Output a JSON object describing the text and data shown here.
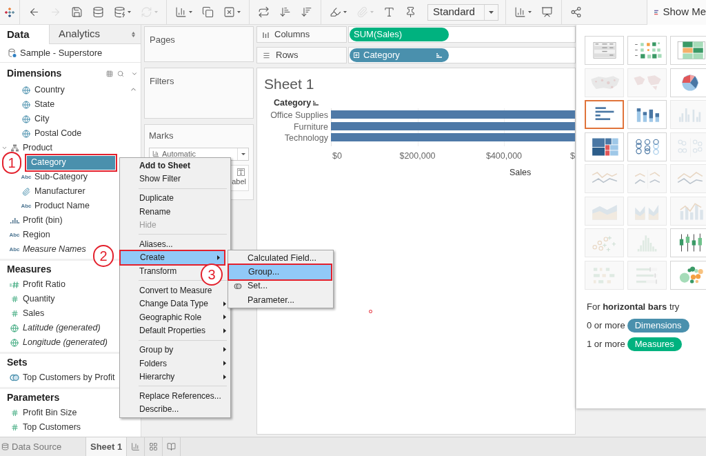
{
  "toolbar": {
    "groups": [
      {
        "items": [
          {
            "kind": "back",
            "disabled": false,
            "has_menu": false
          },
          {
            "kind": "forward",
            "disabled": true,
            "has_menu": false
          },
          {
            "kind": "save",
            "disabled": false,
            "has_menu": false
          },
          {
            "kind": "new_data_source",
            "disabled": false,
            "has_menu": false
          },
          {
            "kind": "pause_updates",
            "disabled": false,
            "has_menu": true
          },
          {
            "kind": "refresh",
            "disabled": true,
            "has_menu": true
          }
        ]
      },
      {
        "items": [
          {
            "kind": "new_sheet",
            "disabled": false,
            "has_menu": true
          },
          {
            "kind": "duplicate",
            "disabled": false,
            "has_menu": false
          },
          {
            "kind": "clear",
            "disabled": false,
            "has_menu": true
          }
        ]
      },
      {
        "items": [
          {
            "kind": "swap",
            "disabled": false,
            "has_menu": false
          },
          {
            "kind": "sort_ascending",
            "disabled": false,
            "has_menu": false
          },
          {
            "kind": "sort_descending",
            "disabled": false,
            "has_menu": false
          }
        ]
      },
      {
        "items": [
          {
            "kind": "highlight",
            "disabled": false,
            "has_menu": true
          },
          {
            "kind": "group_members",
            "disabled": true,
            "has_menu": true
          },
          {
            "kind": "labels",
            "disabled": false,
            "has_menu": false
          },
          {
            "kind": "fix_axes",
            "disabled": false,
            "has_menu": false
          },
          {
            "kind": "fit",
            "value": "Standard"
          }
        ]
      },
      {
        "items": [
          {
            "kind": "show_cards",
            "disabled": false,
            "has_menu": true
          },
          {
            "kind": "presentation",
            "disabled": false,
            "has_menu": false
          }
        ]
      },
      {
        "items": [
          {
            "kind": "share",
            "disabled": false,
            "has_menu": false
          }
        ]
      }
    ],
    "show_me_tab": {
      "label": "Show Me"
    }
  },
  "data_pane": {
    "tabs": [
      {
        "label": "Data",
        "selected": true
      },
      {
        "label": "Analytics",
        "selected": false
      }
    ],
    "data_source": "Sample - Superstore",
    "sections": [
      {
        "title": "Dimensions",
        "has_tools": true,
        "continued_items": [
          {
            "name": "Country",
            "kind": "geo",
            "italic": false,
            "selected": false,
            "annotated": false
          },
          {
            "name": "State",
            "kind": "geo",
            "italic": false,
            "selected": false,
            "annotated": false
          },
          {
            "name": "City",
            "kind": "geo",
            "italic": false,
            "selected": false,
            "annotated": false
          },
          {
            "name": "Postal Code",
            "kind": "geo",
            "italic": false,
            "selected": false,
            "annotated": false
          }
        ],
        "items": [
          {
            "name": "Product",
            "kind": "hierarchy",
            "italic": false,
            "selected": false,
            "annotated": false,
            "expanded": true,
            "children": [
              {
                "name": "Category",
                "kind": "string",
                "italic": false,
                "selected": true,
                "annotated": true
              },
              {
                "name": "Sub-Category",
                "kind": "string",
                "type_label": "Abc",
                "italic": false,
                "selected": false,
                "annotated": false
              },
              {
                "name": "Manufacturer",
                "kind": "group",
                "italic": false,
                "selected": false,
                "annotated": false
              },
              {
                "name": "Product Name",
                "kind": "string",
                "type_label": "Abc",
                "italic": false,
                "selected": false,
                "annotated": false
              }
            ]
          },
          {
            "name": "Profit (bin)",
            "kind": "bin",
            "italic": false,
            "selected": false,
            "annotated": false
          },
          {
            "name": "Region",
            "kind": "string",
            "type_label": "Abc",
            "italic": false,
            "selected": false,
            "annotated": false
          },
          {
            "name": "Measure Names",
            "kind": "string",
            "type_label": "Abc",
            "italic": true,
            "selected": false,
            "annotated": false
          }
        ]
      },
      {
        "title": "Measures",
        "has_tools": false,
        "items": [
          {
            "name": "Profit Ratio",
            "kind": "calc_measure",
            "italic": false,
            "selected": false,
            "annotated": false
          },
          {
            "name": "Quantity",
            "kind": "measure",
            "italic": false,
            "selected": false,
            "annotated": false
          },
          {
            "name": "Sales",
            "kind": "measure",
            "italic": false,
            "selected": false,
            "annotated": false
          },
          {
            "name": "Latitude (generated)",
            "kind": "geo_measure",
            "italic": true,
            "selected": false,
            "annotated": false
          },
          {
            "name": "Longitude (generated)",
            "kind": "geo_measure",
            "italic": true,
            "selected": false,
            "annotated": false
          }
        ]
      },
      {
        "title": "Sets",
        "has_tools": false,
        "items": [
          {
            "name": "Top Customers by Profit",
            "kind": "set",
            "italic": false,
            "selected": false,
            "annotated": false
          }
        ]
      },
      {
        "title": "Parameters",
        "has_tools": false,
        "items": [
          {
            "name": "Profit Bin Size",
            "kind": "parameter",
            "italic": false,
            "selected": false,
            "annotated": false
          },
          {
            "name": "Top Customers",
            "kind": "parameter",
            "italic": false,
            "selected": false,
            "annotated": false
          }
        ]
      }
    ]
  },
  "cards": {
    "pages": {
      "title": "Pages"
    },
    "filters": {
      "title": "Filters"
    },
    "marks": {
      "title": "Marks",
      "mark_type": "Automatic",
      "partial_button": "abel"
    }
  },
  "shelves": [
    {
      "label": "Columns",
      "kind": "columns",
      "pills": [
        {
          "text": "SUM(Sales)",
          "kind": "measure",
          "expandable": false,
          "sorted": false
        }
      ]
    },
    {
      "label": "Rows",
      "kind": "rows",
      "pills": [
        {
          "text": "Category",
          "kind": "dimension",
          "expandable": true,
          "sorted": true
        }
      ]
    }
  ],
  "view": {
    "title": "Sheet 1",
    "row_header": "Category",
    "row_header_sorted": true,
    "rows": [
      "Office Supplies",
      "Furniture",
      "Technology"
    ],
    "axis_ticks": [
      "$0",
      "$200,000",
      "$400,000",
      "$"
    ],
    "axis_title": "Sales"
  },
  "context_menu": {
    "groups": [
      {
        "items": [
          {
            "label": "Add to Sheet",
            "bold": true,
            "disabled": false,
            "has_submenu": false,
            "selected": false,
            "annotated": false
          },
          {
            "label": "Show Filter",
            "bold": false,
            "disabled": false,
            "has_submenu": false,
            "selected": false,
            "annotated": false
          }
        ]
      },
      {
        "items": [
          {
            "label": "Duplicate",
            "bold": false,
            "disabled": false,
            "has_submenu": false,
            "selected": false,
            "annotated": false
          },
          {
            "label": "Rename",
            "bold": false,
            "disabled": false,
            "has_submenu": false,
            "selected": false,
            "annotated": false
          },
          {
            "label": "Hide",
            "bold": false,
            "disabled": true,
            "has_submenu": false,
            "selected": false,
            "annotated": false
          }
        ]
      },
      {
        "items": [
          {
            "label": "Aliases...",
            "bold": false,
            "disabled": false,
            "has_submenu": false,
            "selected": false,
            "annotated": false
          },
          {
            "label": "Create",
            "bold": false,
            "disabled": false,
            "has_submenu": true,
            "selected": true,
            "annotated": true
          },
          {
            "label": "Transform",
            "bold": false,
            "disabled": false,
            "has_submenu": false,
            "selected": false,
            "annotated": false
          }
        ]
      },
      {
        "items": [
          {
            "label": "Convert to Measure",
            "bold": false,
            "disabled": false,
            "has_submenu": false,
            "selected": false,
            "annotated": false
          },
          {
            "label": "Change Data Type",
            "bold": false,
            "disabled": false,
            "has_submenu": true,
            "selected": false,
            "annotated": false
          },
          {
            "label": "Geographic Role",
            "bold": false,
            "disabled": false,
            "has_submenu": true,
            "selected": false,
            "annotated": false
          },
          {
            "label": "Default Properties",
            "bold": false,
            "disabled": false,
            "has_submenu": true,
            "selected": false,
            "annotated": false
          }
        ]
      },
      {
        "items": [
          {
            "label": "Group by",
            "bold": false,
            "disabled": false,
            "has_submenu": true,
            "selected": false,
            "annotated": false
          },
          {
            "label": "Folders",
            "bold": false,
            "disabled": false,
            "has_submenu": true,
            "selected": false,
            "annotated": false
          },
          {
            "label": "Hierarchy",
            "bold": false,
            "disabled": false,
            "has_submenu": true,
            "selected": false,
            "annotated": false
          }
        ]
      },
      {
        "items": [
          {
            "label": "Replace References...",
            "bold": false,
            "disabled": false,
            "has_submenu": false,
            "selected": false,
            "annotated": false
          },
          {
            "label": "Describe...",
            "bold": false,
            "disabled": false,
            "has_submenu": false,
            "selected": false,
            "annotated": false
          }
        ]
      }
    ]
  },
  "submenu": {
    "items": [
      {
        "label": "Calculated Field...",
        "kind": "plain",
        "selected": false,
        "annotated": false
      },
      {
        "label": "Group...",
        "kind": "plain",
        "selected": true,
        "annotated": true
      },
      {
        "label": "Set...",
        "kind": "set",
        "selected": false,
        "annotated": false
      },
      {
        "label": "Parameter...",
        "kind": "plain",
        "selected": false,
        "annotated": false
      }
    ]
  },
  "annotations": [
    {
      "label": "1"
    },
    {
      "label": "2"
    },
    {
      "label": "3"
    }
  ],
  "show_me": {
    "chart_types": [
      {
        "kind": "text_table",
        "disabled": false,
        "selected": false
      },
      {
        "kind": "heat_map",
        "disabled": false,
        "selected": false
      },
      {
        "kind": "highlight_table",
        "disabled": false,
        "selected": false
      },
      {
        "kind": "symbol_map",
        "disabled": true,
        "selected": false
      },
      {
        "kind": "filled_map",
        "disabled": true,
        "selected": false
      },
      {
        "kind": "pie",
        "disabled": false,
        "selected": false
      },
      {
        "kind": "horizontal_bars",
        "disabled": false,
        "selected": true
      },
      {
        "kind": "stacked_bars",
        "disabled": false,
        "selected": false
      },
      {
        "kind": "side_by_side_bars",
        "disabled": true,
        "selected": false
      },
      {
        "kind": "treemap",
        "disabled": false,
        "selected": false
      },
      {
        "kind": "circle_view",
        "disabled": false,
        "selected": false
      },
      {
        "kind": "side_by_side_circles",
        "disabled": true,
        "selected": false
      },
      {
        "kind": "lines_continuous",
        "disabled": true,
        "selected": false
      },
      {
        "kind": "lines_discrete",
        "disabled": true,
        "selected": false
      },
      {
        "kind": "dual_lines",
        "disabled": true,
        "selected": false
      },
      {
        "kind": "area_continuous",
        "disabled": true,
        "selected": false
      },
      {
        "kind": "area_discrete",
        "disabled": true,
        "selected": false
      },
      {
        "kind": "dual_combination",
        "disabled": true,
        "selected": false
      },
      {
        "kind": "scatter",
        "disabled": true,
        "selected": false
      },
      {
        "kind": "histogram",
        "disabled": true,
        "selected": false
      },
      {
        "kind": "box_whisker",
        "disabled": false,
        "selected": false
      },
      {
        "kind": "gantt",
        "disabled": true,
        "selected": false
      },
      {
        "kind": "bullet",
        "disabled": true,
        "selected": false
      },
      {
        "kind": "packed_bubbles",
        "disabled": false,
        "selected": false
      }
    ],
    "hint": "For **horizontal bars** try",
    "requirements": [
      {
        "text": "0 or more",
        "pill": "Dimensions",
        "kind": "dimension"
      },
      {
        "text": "1 or more",
        "pill": "Measures",
        "kind": "measure"
      }
    ]
  },
  "bottom_bar": {
    "tabs": [
      {
        "label": "Data Source",
        "kind": "data_source",
        "selected": false
      },
      {
        "label": "Sheet 1",
        "kind": "sheet",
        "selected": true
      }
    ],
    "actions": [
      {
        "kind": "new_worksheet"
      },
      {
        "kind": "new_dashboard"
      },
      {
        "kind": "new_story"
      }
    ]
  }
}
